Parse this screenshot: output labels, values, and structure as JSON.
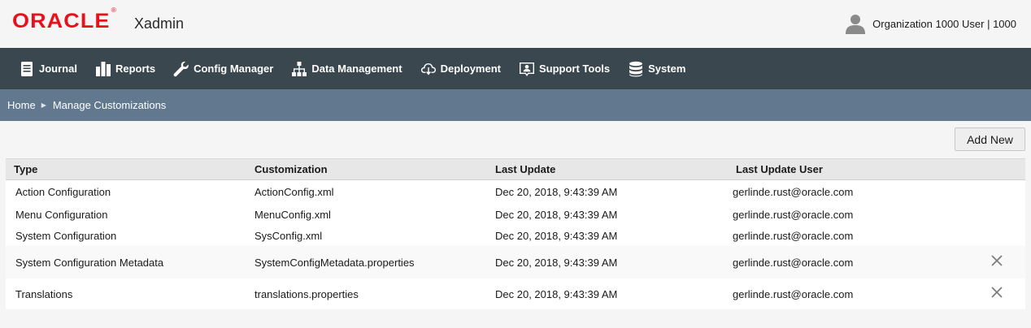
{
  "header": {
    "logo": "ORACLE",
    "logo_mark": "®",
    "app_name": "Xadmin",
    "user_icon": "person-icon",
    "user_label": "Organization 1000 User | 1000"
  },
  "nav": [
    {
      "label": "Journal",
      "icon": "journal-icon"
    },
    {
      "label": "Reports",
      "icon": "bar-chart-icon"
    },
    {
      "label": "Config Manager",
      "icon": "wrench-icon"
    },
    {
      "label": "Data Management",
      "icon": "hierarchy-icon"
    },
    {
      "label": "Deployment",
      "icon": "cloud-download-icon"
    },
    {
      "label": "Support Tools",
      "icon": "support-icon"
    },
    {
      "label": "System",
      "icon": "database-icon"
    }
  ],
  "breadcrumb": {
    "home": "Home",
    "separator": "▶",
    "current": "Manage Customizations"
  },
  "toolbar": {
    "add_new_label": "Add New"
  },
  "table": {
    "columns": [
      "Type",
      "Customization",
      "Last Update",
      "Last Update User"
    ],
    "rows": [
      {
        "type": "Action Configuration",
        "customization": "ActionConfig.xml",
        "last_update": "Dec 20, 2018, 9:43:39 AM",
        "user": "gerlinde.rust@oracle.com",
        "deletable": false
      },
      {
        "type": "Menu Configuration",
        "customization": "MenuConfig.xml",
        "last_update": "Dec 20, 2018, 9:43:39 AM",
        "user": "gerlinde.rust@oracle.com",
        "deletable": false
      },
      {
        "type": "System Configuration",
        "customization": "SysConfig.xml",
        "last_update": "Dec 20, 2018, 9:43:39 AM",
        "user": "gerlinde.rust@oracle.com",
        "deletable": false
      },
      {
        "type": "System Configuration Metadata",
        "customization": "SystemConfigMetadata.properties",
        "last_update": "Dec 20, 2018, 9:43:39 AM",
        "user": "gerlinde.rust@oracle.com",
        "deletable": true
      },
      {
        "type": "Translations",
        "customization": "translations.properties",
        "last_update": "Dec 20, 2018, 9:43:39 AM",
        "user": "gerlinde.rust@oracle.com",
        "deletable": true
      }
    ]
  },
  "colors": {
    "brand_red": "#e8111b",
    "navbar": "#3a474e",
    "breadcrumb_bar": "#61788f"
  }
}
